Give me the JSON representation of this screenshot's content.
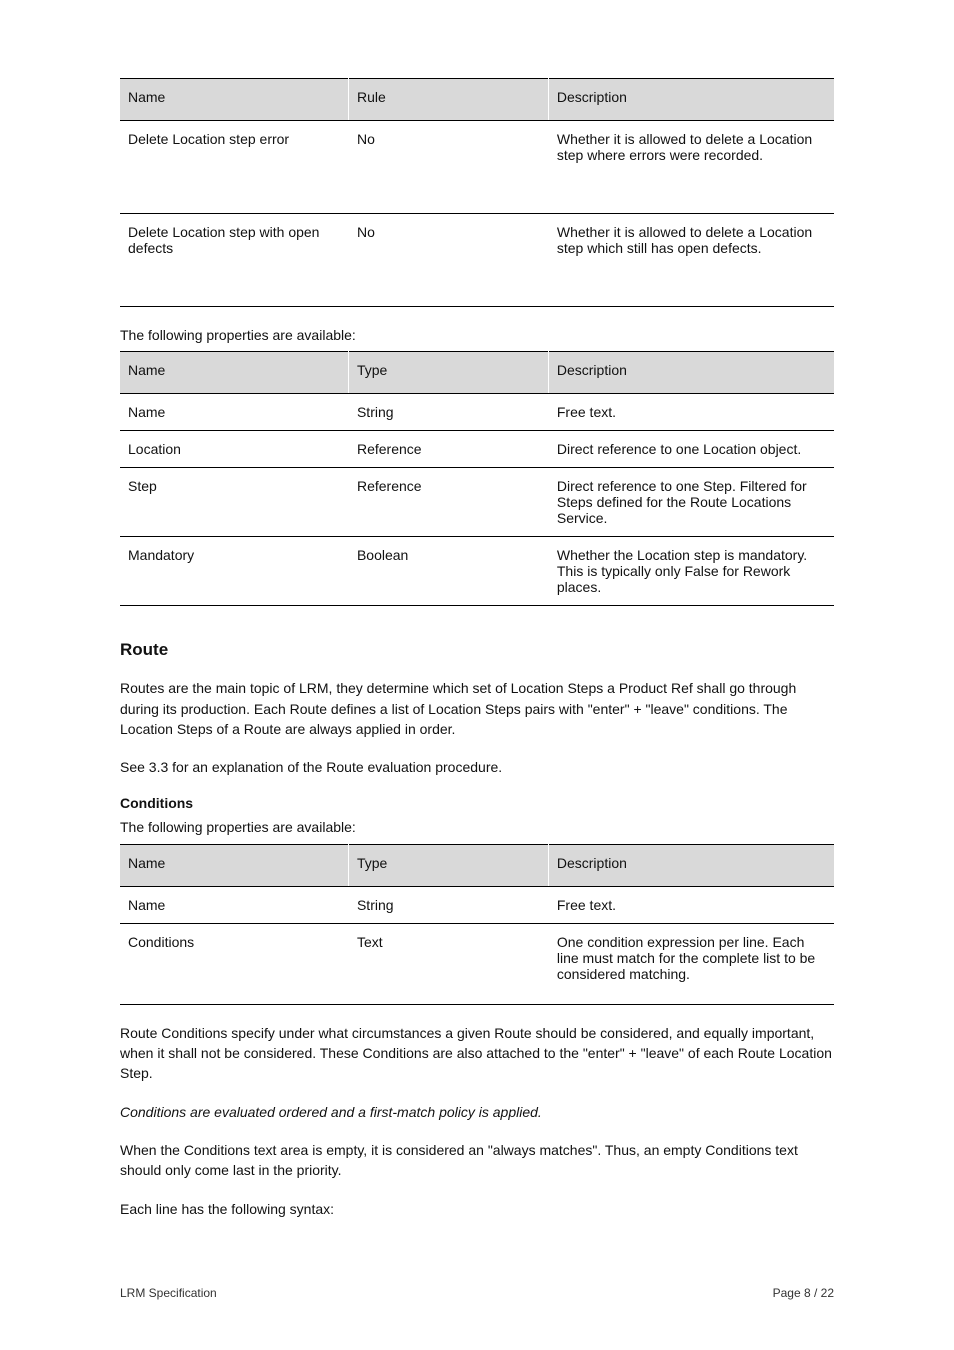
{
  "tableA": {
    "caption": "",
    "headers": [
      "Name",
      "Rule",
      "Description"
    ],
    "rows": [
      {
        "name": "Delete Location step error",
        "rule": "No",
        "desc": "Whether it is allowed to delete a Location step where errors were recorded."
      },
      {
        "name": "Delete Location step with open defects",
        "rule": "No",
        "desc": "Whether it is allowed to delete a Location step which still has open defects."
      }
    ]
  },
  "tableB_lead": "The following properties are available:",
  "tableB": {
    "headers": [
      "Name",
      "Type",
      "Description"
    ],
    "rows": [
      {
        "name": "Name",
        "type": "String",
        "desc": "Free text."
      },
      {
        "name": "Location",
        "type": "Reference",
        "desc": "Direct reference to one Location object."
      },
      {
        "name": "Step",
        "type": "Reference",
        "desc": "Direct reference to one Step. Filtered for Steps defined for the Route Locations Service."
      },
      {
        "name": "Mandatory",
        "type": "Boolean",
        "desc": "Whether the Location step is mandatory. This is typically only False for Rework places."
      }
    ]
  },
  "h_route": "Route",
  "p_route1": "Routes are the main topic of LRM, they determine which set of Location Steps a Product Ref shall go through during its production. Each Route defines a list of Location Steps pairs with \"enter\" + \"leave\" conditions. The Location Steps of a Route are always applied in order.",
  "p_route2": "See 3.3 for an explanation of the Route evaluation procedure.",
  "h_cond": "Conditions",
  "p_cond_lead": "The following properties are available:",
  "tableC": {
    "headers": [
      "Name",
      "Type",
      "Description"
    ],
    "rows": [
      {
        "name": "Name",
        "type": "String",
        "desc": "Free text."
      },
      {
        "name": "Conditions",
        "type": "Text",
        "desc": "One condition expression per line. Each line must match for the complete list to be considered matching."
      }
    ]
  },
  "p_cond1": "Route Conditions specify under what circumstances a given Route should be considered, and equally important, when it shall not be considered. These Conditions are also attached to the \"enter\" + \"leave\" of each Route Location Step.",
  "p_cond2": "Conditions are evaluated ordered and a first-match policy is applied.",
  "p_cond3": "When the Conditions text area is empty, it is considered an \"always matches\". Thus, an empty Conditions text should only come last in the priority.",
  "p_cond4": "Each line has the following syntax:",
  "footer_left": "LRM Specification",
  "footer_right": "Page 8 / 22"
}
